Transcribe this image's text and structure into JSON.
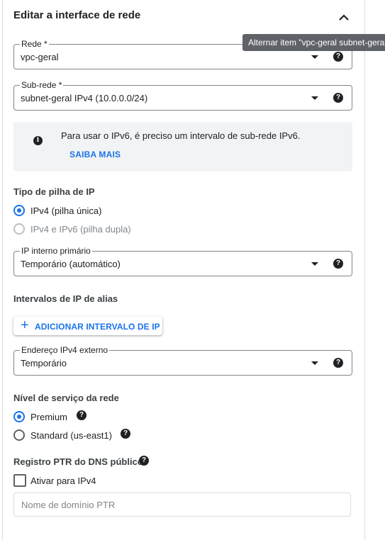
{
  "header": {
    "title": "Editar a interface de rede"
  },
  "tooltip": {
    "text": "Alternar item \"vpc-geral subnet-geral"
  },
  "network": {
    "label": "Rede *",
    "value": "vpc-geral"
  },
  "subnet": {
    "label": "Sub-rede *",
    "value": "subnet-geral IPv4 (10.0.0.0/24)"
  },
  "info": {
    "text": "Para usar o IPv6, é preciso um intervalo de sub-rede IPv6.",
    "link": "SAIBA MAIS"
  },
  "stack": {
    "title": "Tipo de pilha de IP",
    "options": [
      {
        "label": "IPv4 (pilha única)",
        "selected": true,
        "disabled": false
      },
      {
        "label": "IPv4 e IPv6 (pilha dupla)",
        "selected": false,
        "disabled": true
      }
    ]
  },
  "internal_ip": {
    "label": "IP interno primário",
    "value": "Temporário (automático)"
  },
  "alias": {
    "title": "Intervalos de IP de alias",
    "button": "ADICIONAR INTERVALO DE IP"
  },
  "external_ip": {
    "label": "Endereço IPv4 externo",
    "value": "Temporário"
  },
  "tier": {
    "title": "Nível de serviço da rede",
    "options": [
      {
        "label": "Premium",
        "selected": true
      },
      {
        "label": "Standard (us-east1)",
        "selected": false
      }
    ]
  },
  "ptr": {
    "title": "Registro PTR do DNS público",
    "checkbox_label": "Ativar para IPv4",
    "checked": false,
    "placeholder": "Nome de domínio PTR"
  },
  "colors": {
    "accent": "#1a73e8",
    "info_bg": "#f1f3f4"
  },
  "icons": {
    "help": "help-circle-icon",
    "info": "info-circle-icon",
    "collapse": "chevron-up-icon",
    "dropdown": "caret-down-icon",
    "add": "plus-icon"
  }
}
